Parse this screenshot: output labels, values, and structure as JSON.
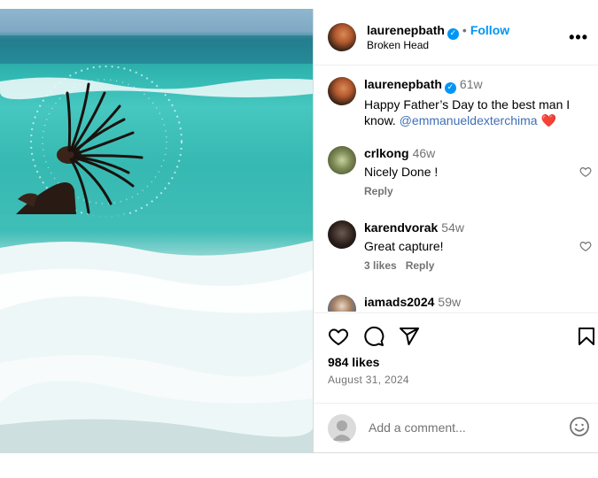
{
  "post": {
    "author": "laurenepbath",
    "follow_label": "Follow",
    "location": "Broken Head",
    "more_label": "•••",
    "dot": "•"
  },
  "caption": {
    "username": "laurenepbath",
    "time": "61w",
    "text": "Happy Father’s Day to the best man I know.",
    "mention": "@emmanueldexterchima",
    "emoji": "❤️"
  },
  "comments": [
    {
      "username": "crlkong",
      "time": "46w",
      "text": "Nicely Done !",
      "likes": "",
      "reply": "Reply"
    },
    {
      "username": "karendvorak",
      "time": "54w",
      "text": "Great capture!",
      "likes": "3 likes",
      "reply": "Reply"
    },
    {
      "username": "iamads2024",
      "time": "59w",
      "text": "",
      "likes": "",
      "reply": ""
    }
  ],
  "stats": {
    "likes": "984 likes",
    "date": "August 31, 2024"
  },
  "composer": {
    "placeholder": "Add a comment..."
  },
  "colors": {
    "accent": "#0095f6",
    "heart": "#ed4956",
    "muted": "#737373"
  },
  "icons": [
    "heart-icon",
    "comment-icon",
    "share-icon",
    "bookmark-icon",
    "emoji-icon",
    "verified-icon",
    "more-icon"
  ]
}
